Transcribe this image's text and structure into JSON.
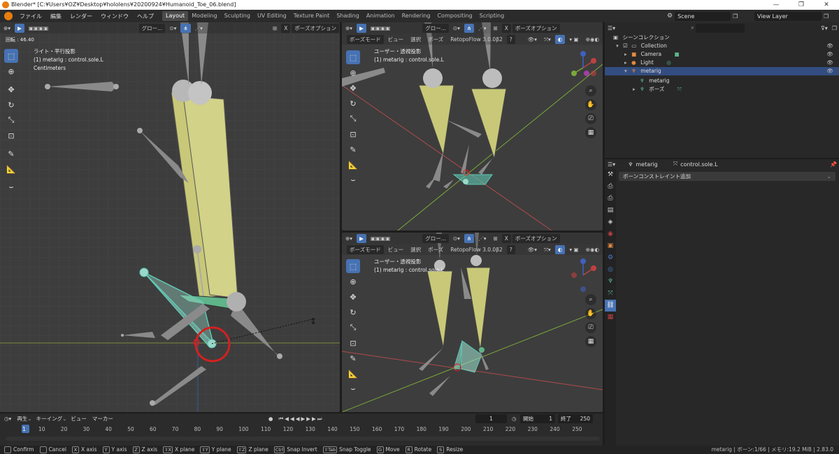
{
  "title_bar": {
    "title": "Blender* [C:¥Users¥OZ¥Desktop¥hololens¥20200924¥Humanoid_Toe_06.blend]",
    "minimize": "—",
    "maximize": "❐",
    "close": "✕"
  },
  "menu": [
    "ファイル",
    "編集",
    "レンダー",
    "ウィンドウ",
    "ヘルプ"
  ],
  "workspaces": [
    "Layout",
    "Modeling",
    "Sculpting",
    "UV Editing",
    "Texture Paint",
    "Shading",
    "Animation",
    "Rendering",
    "Compositing",
    "Scripting"
  ],
  "active_workspace": "Layout",
  "scene": {
    "label": "Scene",
    "view_layer": "View Layer"
  },
  "left_viewport": {
    "header": {
      "transform_orientation": "グロー...",
      "pose_options": "ポーズオプション",
      "close_x": "X"
    },
    "rotation_readout": "回転 : 46.40",
    "view_name": "ライト・平行投影",
    "active_object": "(1) metarig : control.sole.L",
    "units": "Centimeters"
  },
  "top_right_viewport": {
    "header": {
      "mode": "ボーズモード",
      "view": "ビュー",
      "select": "選択",
      "pose": "ポーズ",
      "transform_orientation": "グロー...",
      "retopoflow": "RetopoFlow 3.0.0β2",
      "help": "?",
      "pose_options": "ボーズオプション",
      "close_x": "X"
    },
    "view_name": "ユーザー・透視投影",
    "active_object": "(1) metarig : control.sole.L"
  },
  "bottom_right_viewport": {
    "header": {
      "mode": "ボーズモード",
      "view": "ビュー",
      "select": "選択",
      "pose": "ポーズ",
      "transform_orientation": "グロー...",
      "retopoflow": "RetopoFlow 3.0.0β2",
      "help": "?",
      "pose_options": "ボーズオプション",
      "close_x": "X"
    },
    "view_name": "ユーザー・透視投影",
    "active_object": "(1) metarig : control.sole.L"
  },
  "outliner": {
    "search_placeholder": "",
    "rows": [
      {
        "label": "シーンコレクション",
        "indent": 0,
        "icon": "scene-collection-icon"
      },
      {
        "label": "Collection",
        "indent": 1,
        "icon": "collection-icon"
      },
      {
        "label": "Camera",
        "indent": 2,
        "icon": "camera-icon"
      },
      {
        "label": "Light",
        "indent": 2,
        "icon": "light-icon"
      },
      {
        "label": "metarig",
        "indent": 2,
        "icon": "armature-icon",
        "selected": true
      },
      {
        "label": "metarig",
        "indent": 3,
        "icon": "armature-data-icon"
      },
      {
        "label": "ボーズ",
        "indent": 3,
        "icon": "pose-icon"
      }
    ]
  },
  "properties": {
    "object": "metarig",
    "bone": "control.sole.L",
    "add_constraint": "ボーンコンストレイント追加"
  },
  "timeline": {
    "menus": [
      "再生",
      "キーイング",
      "ビュー",
      "マーカー"
    ],
    "current_frame": "1",
    "start_label": "開始",
    "start": "1",
    "end_label": "終了",
    "end": "250",
    "ruler": [
      "1",
      "10",
      "20",
      "30",
      "40",
      "50",
      "60",
      "70",
      "80",
      "90",
      "100",
      "110",
      "120",
      "130",
      "140",
      "150",
      "160",
      "170",
      "180",
      "190",
      "200",
      "210",
      "220",
      "230",
      "240",
      "250"
    ]
  },
  "status_bar": {
    "items": [
      {
        "key": "",
        "label": "Confirm"
      },
      {
        "key": "",
        "label": "Cancel"
      },
      {
        "key": "X",
        "label": "X axis"
      },
      {
        "key": "Y",
        "label": "Y axis"
      },
      {
        "key": "Z",
        "label": "Z axis"
      },
      {
        "key": "⇧X",
        "label": "X plane"
      },
      {
        "key": "⇧Y",
        "label": "Y plane"
      },
      {
        "key": "⇧Z",
        "label": "Z plane"
      },
      {
        "key": "Ctrl",
        "label": "Snap Invert"
      },
      {
        "key": "⇧Tab",
        "label": "Snap Toggle"
      },
      {
        "key": "G",
        "label": "Move"
      },
      {
        "key": "R",
        "label": "Rotate"
      },
      {
        "key": "S",
        "label": "Resize"
      }
    ],
    "right": "metarig | ボーン:1/66 | メモリ:19.2 MiB | 2.83.0"
  },
  "colors": {
    "bone_yellow": "#c8c878",
    "bone_gray": "#8a8a8a",
    "bone_selected": "#5fc8b4",
    "red_circle": "#d42020",
    "x_axis": "#b04a4a",
    "y_axis": "#7aa93a"
  }
}
